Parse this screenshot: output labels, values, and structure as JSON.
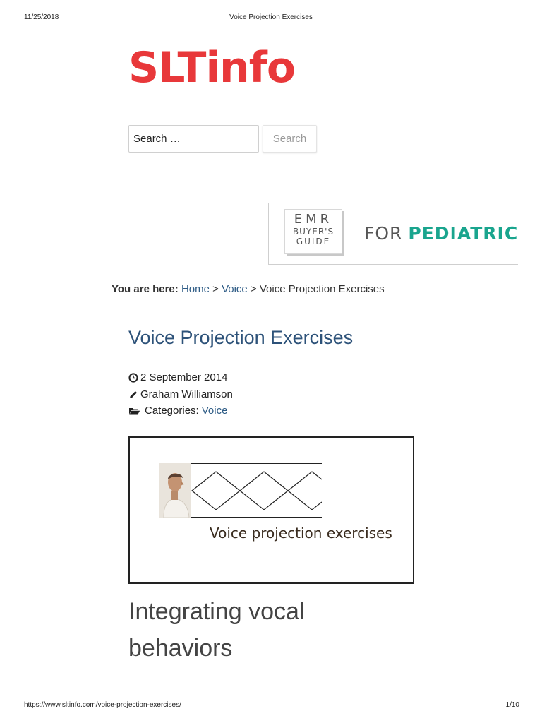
{
  "print_header": {
    "date": "11/25/2018",
    "title": "Voice Projection Exercises"
  },
  "print_footer": {
    "url": "https://www.sltinfo.com/voice-projection-exercises/",
    "page": "1/10"
  },
  "site": {
    "logo_text": "SLTinfo",
    "brand_color": "#e8383a"
  },
  "search": {
    "placeholder": "Search …",
    "button_label": "Search"
  },
  "ad": {
    "line1": "EMR",
    "line2": "BUYER'S",
    "line3": "GUIDE",
    "tagline_for": "FOR",
    "tagline_pediatric": "PEDIATRIC",
    "accent_color": "#1aa58e"
  },
  "breadcrumb": {
    "prefix": "You are here:",
    "home": "Home",
    "sep": ">",
    "voice": "Voice",
    "current": "Voice Projection Exercises"
  },
  "post": {
    "title": "Voice Projection Exercises",
    "date": "2 September 2014",
    "author": "Graham Williamson",
    "categories_label": "Categories:",
    "category": "Voice",
    "image_caption": "Voice projection exercises",
    "section_heading": "Integrating vocal behaviors"
  },
  "icons": {
    "date": "clock-icon",
    "author": "pencil-icon",
    "categories": "folder-open-icon"
  },
  "colors": {
    "link": "#2d5b85",
    "title": "#2d5279"
  }
}
